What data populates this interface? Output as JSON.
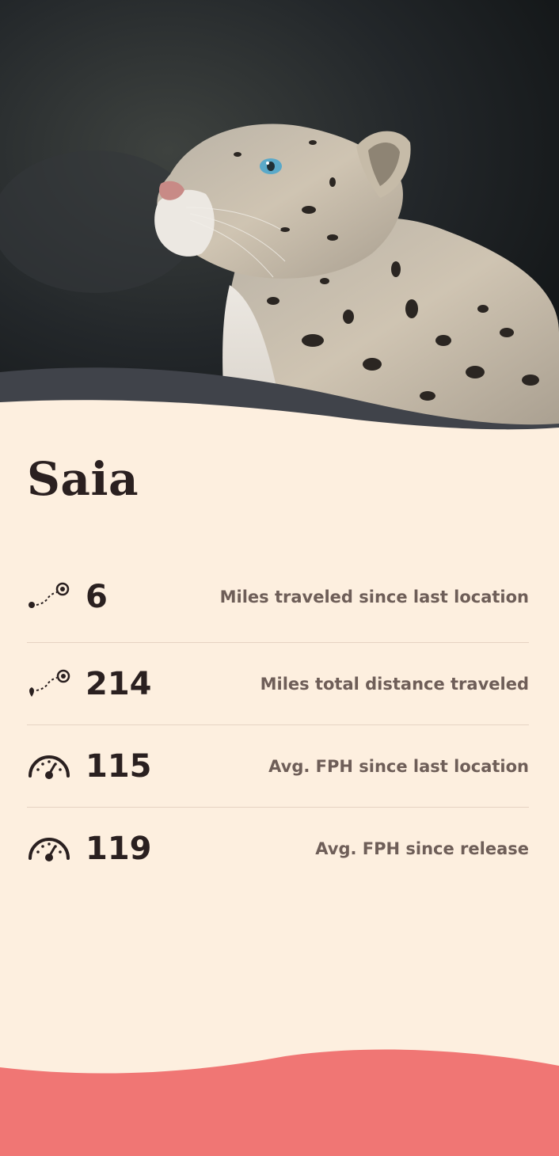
{
  "hero": {
    "image": "snow-leopard-photo",
    "wave_color": "#40434a"
  },
  "animal": {
    "name": "Saia"
  },
  "stats": [
    {
      "icon": "route-start-icon",
      "value": "6",
      "label": "Miles traveled since last location"
    },
    {
      "icon": "route-total-icon",
      "value": "214",
      "label": "Miles total distance traveled"
    },
    {
      "icon": "speedometer-icon",
      "value": "115",
      "label": "Avg. FPH since last location"
    },
    {
      "icon": "speedometer-icon",
      "value": "119",
      "label": "Avg. FPH since release"
    }
  ],
  "colors": {
    "background": "#fdefdf",
    "footer": "#f07674",
    "text": "#2a2020",
    "muted": "#6e5e58"
  }
}
